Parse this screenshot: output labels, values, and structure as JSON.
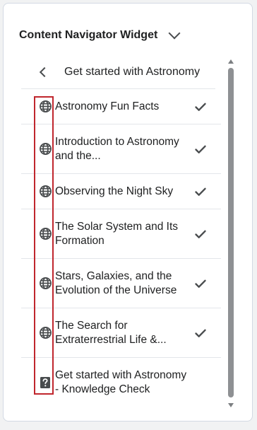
{
  "widget": {
    "title": "Content Navigator Widget"
  },
  "nav": {
    "title": "Get started with Astronomy"
  },
  "items": [
    {
      "label": "Astronomy Fun Facts",
      "icon": "globe-icon",
      "completed": true
    },
    {
      "label": "Introduction to Astronomy and the...",
      "icon": "globe-icon",
      "completed": true
    },
    {
      "label": "Observing the Night Sky",
      "icon": "globe-icon",
      "completed": true
    },
    {
      "label": "The Solar System and Its Formation",
      "icon": "globe-icon",
      "completed": true
    },
    {
      "label": "Stars, Galaxies, and the Evolution of the Universe",
      "icon": "globe-icon",
      "completed": true
    },
    {
      "label": "The Search for Extraterrestrial Life &...",
      "icon": "globe-icon",
      "completed": true
    },
    {
      "label": "Get started with Astronomy - Knowledge Check",
      "icon": "quiz-icon",
      "completed": false
    }
  ],
  "colors": {
    "highlight": "#c0262d",
    "icon": "#494c4e",
    "text": "#202122"
  }
}
